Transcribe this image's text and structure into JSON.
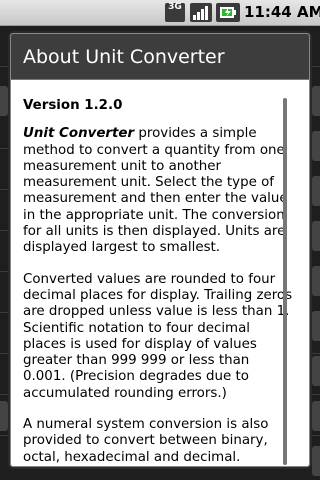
{
  "status_bar": {
    "network_type": "3G",
    "time": "11:44 AM",
    "icons": [
      "3g-icon",
      "signal-icon",
      "battery-icon"
    ]
  },
  "dialog": {
    "title": "About Unit Converter",
    "version": "Version 1.2.0",
    "intro_lead": "Unit Converter",
    "intro_rest": " provides a simple method to convert a quantity from one measurement unit to another measurement unit. Select the type of measurement and then enter the value in the appropriate unit. The conversion for all units is then displayed. Units are displayed largest to smallest.",
    "paragraph_2": "Converted values are rounded to four decimal places for display. Trailing zeros are dropped unless value is less than 1. Scientific notation to four decimal places is used for display of values greater than 999 999 or less than 0.001. (Precision degrades due to accumulated rounding errors.)",
    "paragraph_3": "A numeral system conversion is also provided to convert between binary, octal, hexadecimal and decimal."
  },
  "colors": {
    "title_bar": "#3d3d3d",
    "status_bar": "#d8d8d8",
    "battery_accent": "#2fb52f"
  }
}
